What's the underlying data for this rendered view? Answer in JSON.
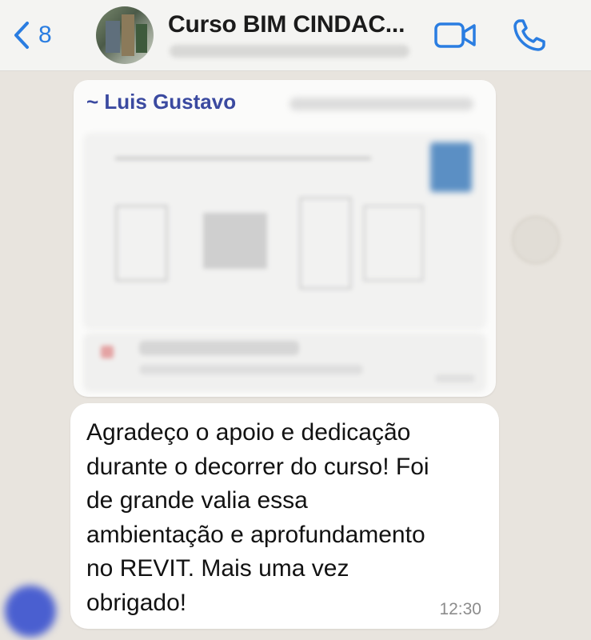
{
  "header": {
    "back_count": "8",
    "chat_title": "Curso BIM CINDAC...",
    "icons": {
      "back": "chevron-left-icon",
      "video": "video-camera-icon",
      "call": "phone-icon"
    },
    "accent_color": "#2a7de1"
  },
  "messages": [
    {
      "sender": "~ Luis Gustavo",
      "type": "document"
    },
    {
      "text": "Agradeço o apoio e dedicação\ndurante o decorrer do curso! Foi\nde grande valia essa\nambientação e aprofundamento\nno REVIT. Mais uma vez\nobrigado!",
      "time": "12:30"
    }
  ]
}
